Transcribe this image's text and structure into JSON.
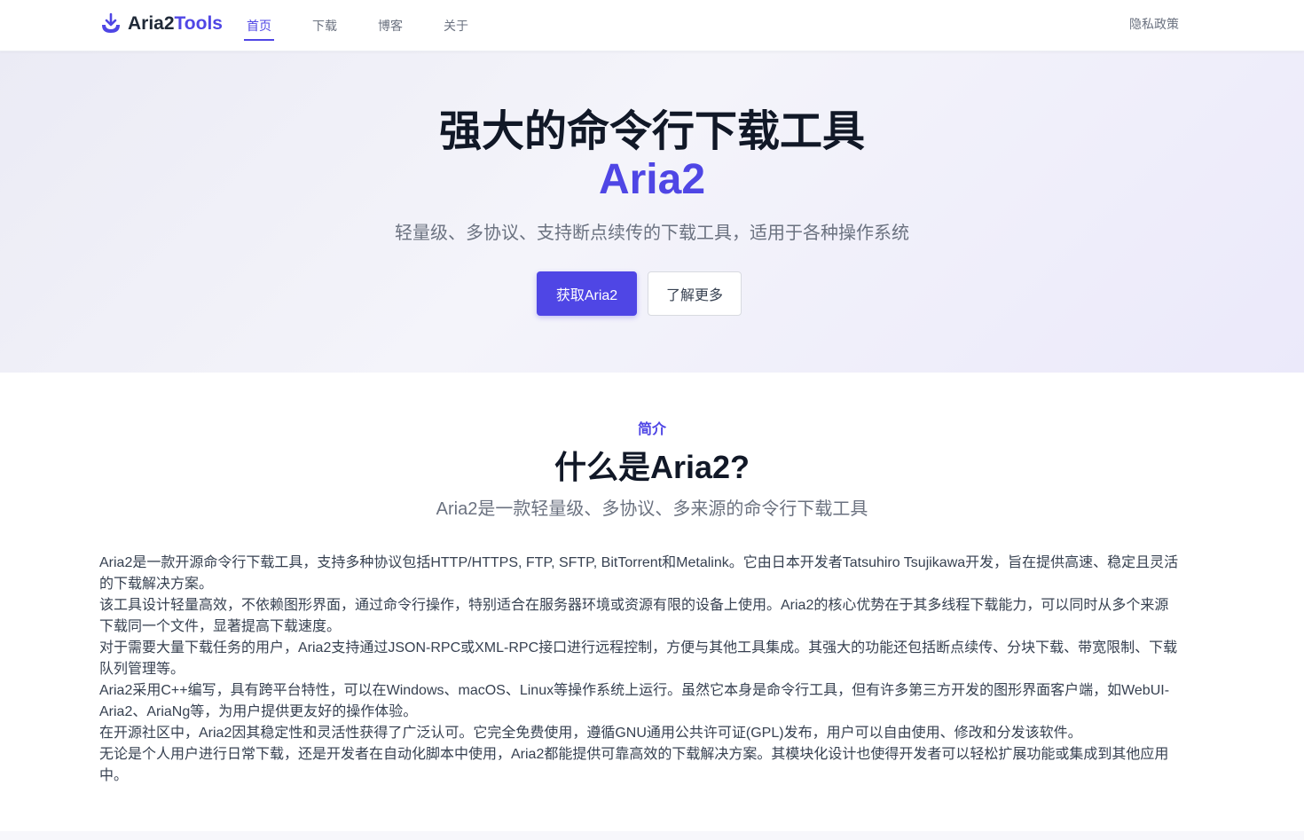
{
  "header": {
    "logo_part1": "Aria2",
    "logo_part2": "Tools",
    "nav": [
      "首页",
      "下载",
      "博客",
      "关于"
    ],
    "privacy": "隐私政策"
  },
  "hero": {
    "title_line1": "强大的命令行下载工具",
    "title_line2": "Aria2",
    "subtitle": "轻量级、多协议、支持断点续传的下载工具，适用于各种操作系统",
    "primary_button": "获取Aria2",
    "secondary_button": "了解更多"
  },
  "intro": {
    "eyebrow": "简介",
    "title": "什么是Aria2?",
    "subtitle": "Aria2是一款轻量级、多协议、多来源的命令行下载工具",
    "paragraphs": [
      "Aria2是一款开源命令行下载工具，支持多种协议包括HTTP/HTTPS, FTP, SFTP, BitTorrent和Metalink。它由日本开发者Tatsuhiro Tsujikawa开发，旨在提供高速、稳定且灵活的下载解决方案。",
      "该工具设计轻量高效，不依赖图形界面，通过命令行操作，特别适合在服务器环境或资源有限的设备上使用。Aria2的核心优势在于其多线程下载能力，可以同时从多个来源下载同一个文件，显著提高下载速度。",
      "对于需要大量下载任务的用户，Aria2支持通过JSON-RPC或XML-RPC接口进行远程控制，方便与其他工具集成。其强大的功能还包括断点续传、分块下载、带宽限制、下载队列管理等。",
      "Aria2采用C++编写，具有跨平台特性，可以在Windows、macOS、Linux等操作系统上运行。虽然它本身是命令行工具，但有许多第三方开发的图形界面客户端，如WebUI-Aria2、AriaNg等，为用户提供更友好的操作体验。",
      "在开源社区中，Aria2因其稳定性和灵活性获得了广泛认可。它完全免费使用，遵循GNU通用公共许可证(GPL)发布，用户可以自由使用、修改和分发该软件。",
      "无论是个人用户进行日常下载，还是开发者在自动化脚本中使用，Aria2都能提供可靠高效的下载解决方案。其模块化设计也使得开发者可以轻松扩展功能或集成到其他应用中。"
    ]
  },
  "colors": {
    "accent": "#4f46e5",
    "title_text": "#111827",
    "muted_text": "#6b7280"
  },
  "icons": {
    "logo": "download-tray-icon"
  }
}
